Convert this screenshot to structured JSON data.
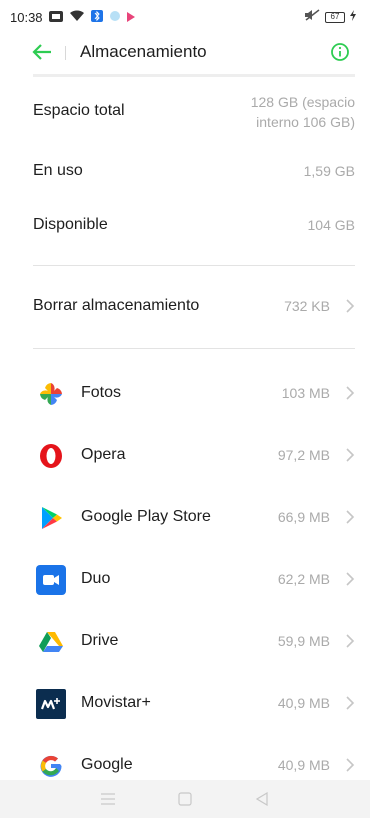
{
  "status_bar": {
    "time": "10:38",
    "battery": "67"
  },
  "header": {
    "title": "Almacenamiento"
  },
  "summary": [
    {
      "label": "Espacio total",
      "value": "128 GB (espacio interno 106 GB)",
      "value_line1": "128 GB (espacio",
      "value_line2": "interno 106 GB)"
    },
    {
      "label": "En uso",
      "value": "1,59 GB"
    },
    {
      "label": "Disponible",
      "value": "104 GB"
    }
  ],
  "clear": {
    "label": "Borrar almacenamiento",
    "value": "732 KB"
  },
  "apps": [
    {
      "name": "Fotos",
      "size": "103 MB",
      "icon": "google-photos-icon"
    },
    {
      "name": "Opera",
      "size": "97,2 MB",
      "icon": "opera-icon"
    },
    {
      "name": "Google Play Store",
      "size": "66,9 MB",
      "icon": "play-store-icon"
    },
    {
      "name": "Duo",
      "size": "62,2 MB",
      "icon": "duo-icon"
    },
    {
      "name": "Drive",
      "size": "59,9 MB",
      "icon": "drive-icon"
    },
    {
      "name": "Movistar+",
      "size": "40,9 MB",
      "icon": "movistar-plus-icon"
    },
    {
      "name": "Google",
      "size": "40,9 MB",
      "icon": "google-icon"
    }
  ],
  "colors": {
    "accent": "#2ecc52",
    "secondary_text": "#aaaaaa",
    "divider": "#e3e3e3"
  }
}
